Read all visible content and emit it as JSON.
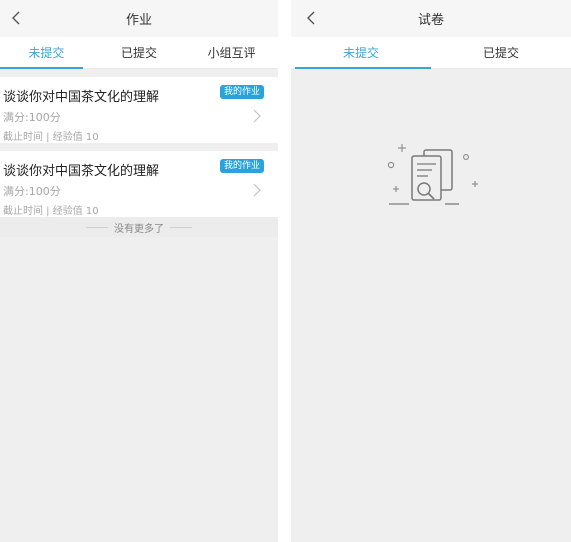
{
  "left": {
    "header": {
      "title": "作业"
    },
    "tabs": [
      {
        "label": "未提交",
        "active": true
      },
      {
        "label": "已提交",
        "active": false
      },
      {
        "label": "小组互评",
        "active": false
      }
    ],
    "assignments": [
      {
        "title": "谈谈你对中国茶文化的理解",
        "badge": "我的作业",
        "score": "满分:100分",
        "meta": "截止时间 | 经验值 10"
      },
      {
        "title": "谈谈你对中国茶文化的理解",
        "badge": "我的作业",
        "score": "满分:100分",
        "meta": "截止时间 | 经验值 10"
      }
    ],
    "no_more": "没有更多了"
  },
  "right": {
    "header": {
      "title": "试卷"
    },
    "tabs": [
      {
        "label": "未提交",
        "active": true
      },
      {
        "label": "已提交",
        "active": false
      }
    ]
  },
  "colors": {
    "accent": "#3aa6d8",
    "badge": "#2aa2dc",
    "background": "#efefef"
  },
  "icons": {
    "back": "chevron-left-icon",
    "row_arrow": "chevron-right-icon",
    "empty": "empty-document-search-icon"
  }
}
